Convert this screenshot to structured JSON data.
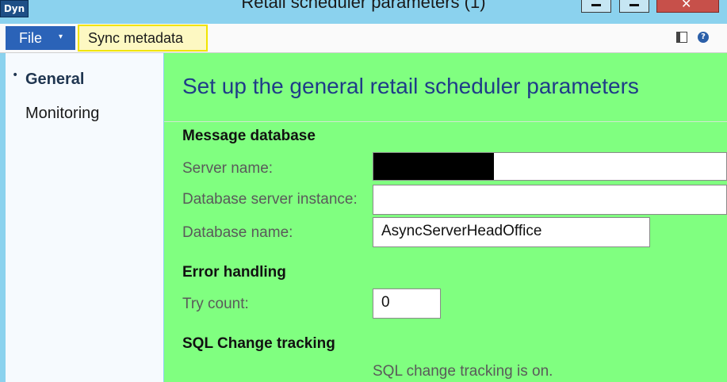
{
  "window": {
    "app_icon": "Dyn",
    "title": "Retail scheduler parameters (1)",
    "close_glyph": "✕"
  },
  "ribbon": {
    "file_label": "File",
    "file_caret": "▾",
    "sync_label": "Sync metadata",
    "icons": [
      "layout-icon",
      "help-icon"
    ],
    "help_glyph": "?"
  },
  "nav": {
    "bullet": "•",
    "items": [
      {
        "label": "General",
        "active": true
      },
      {
        "label": "Monitoring",
        "active": false
      }
    ]
  },
  "main": {
    "heading": "Set up the general retail scheduler parameters",
    "sections": {
      "message_db": "Message database",
      "error_handling": "Error handling",
      "sql_tracking": "SQL Change tracking"
    },
    "fields": {
      "server_name": {
        "label": "Server name:",
        "value": "",
        "redacted": true
      },
      "db_instance": {
        "label": "Database server instance:",
        "value": ""
      },
      "db_name": {
        "label": "Database name:",
        "value": "AsyncServerHeadOffice"
      },
      "try_count": {
        "label": "Try count:",
        "value": "0"
      }
    },
    "sql_status": "SQL change tracking is on."
  },
  "colors": {
    "content_bg": "#80ff80",
    "file_button": "#2b63b8",
    "highlight_border": "#f1e400",
    "heading": "#1f3c88"
  }
}
